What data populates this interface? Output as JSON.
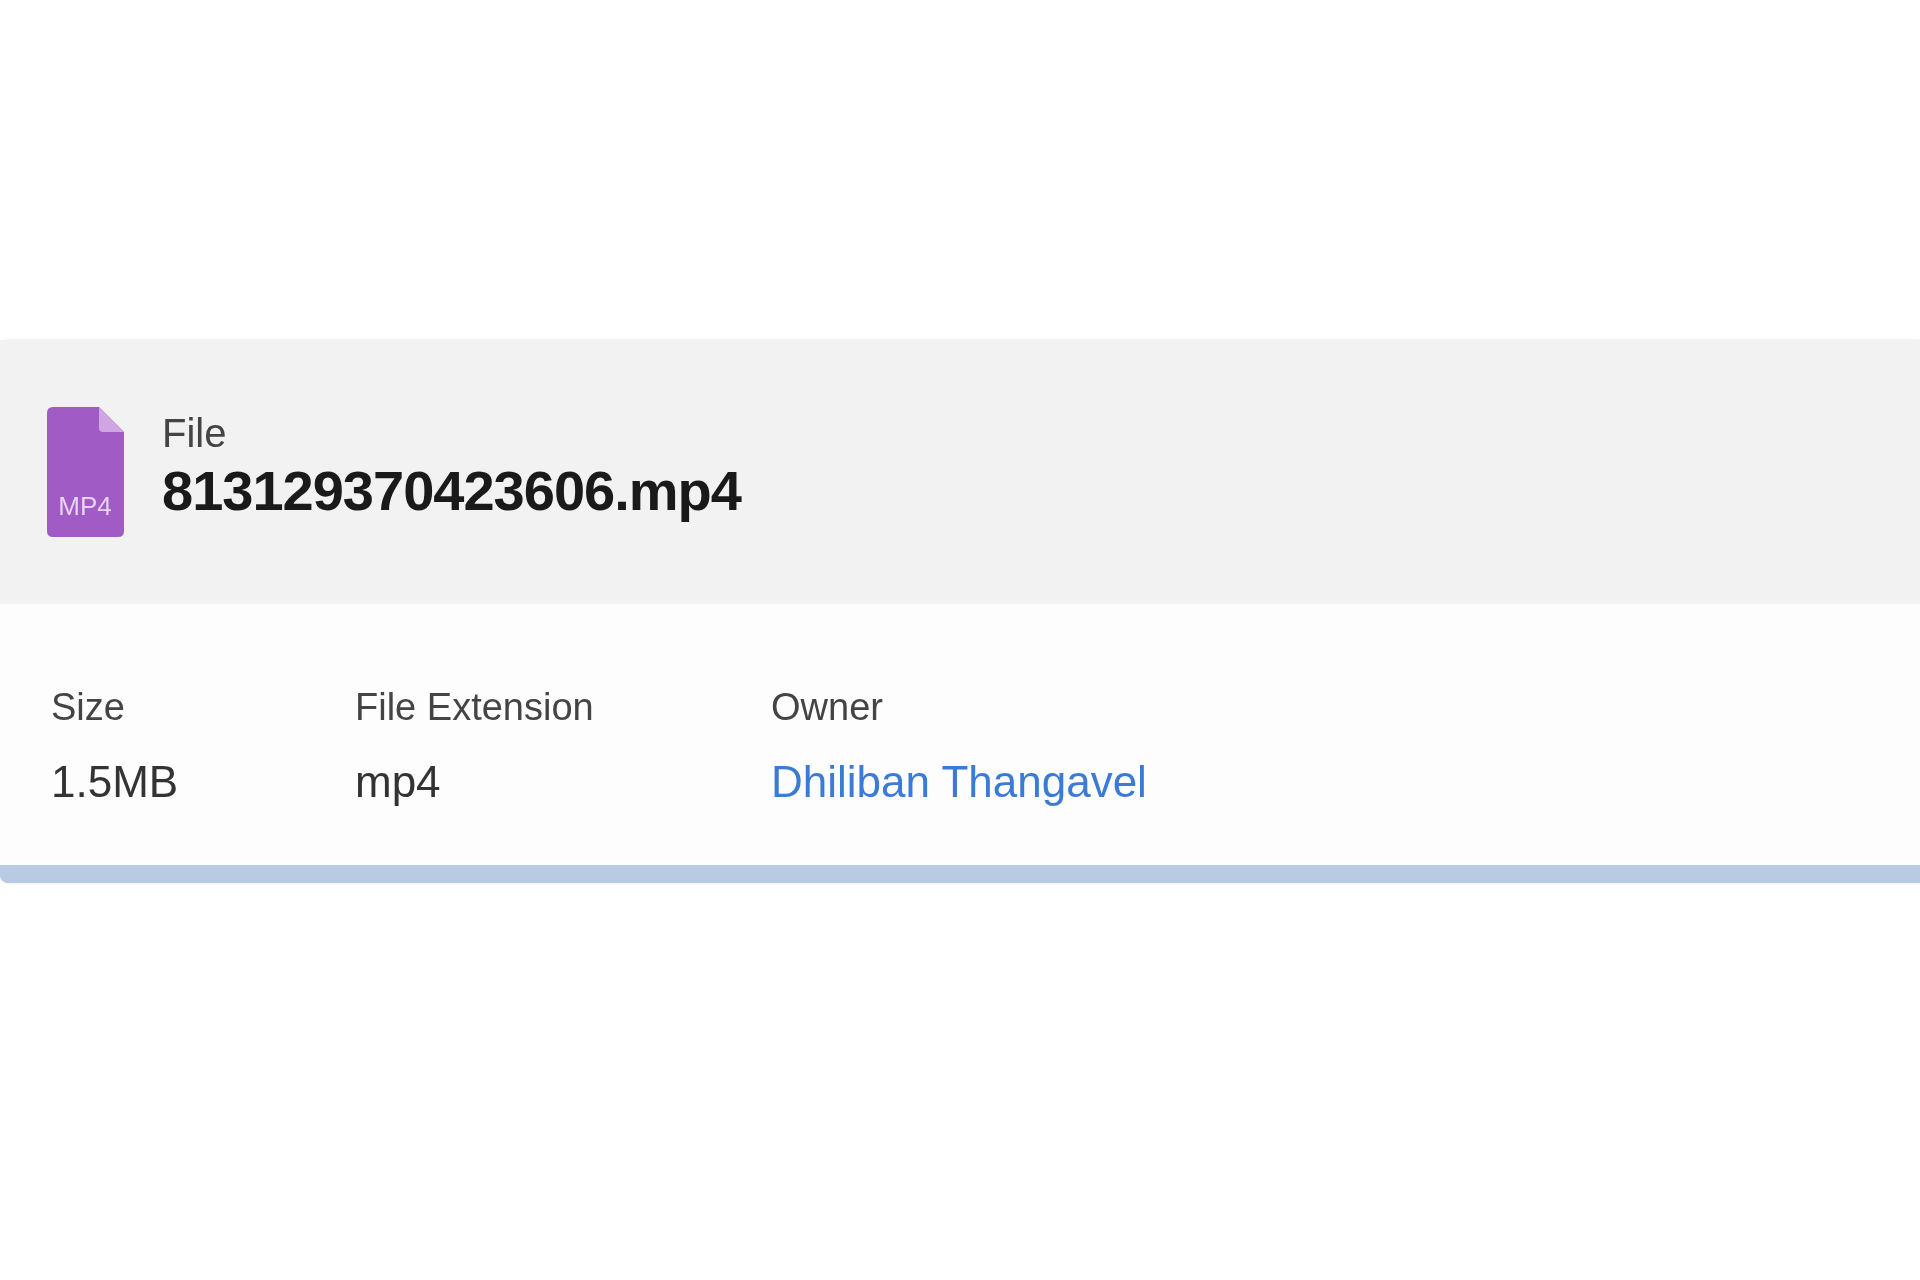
{
  "file": {
    "type_label": "File",
    "name": "813129370423606.mp4",
    "icon_text": "MP4"
  },
  "details": [
    {
      "label": "Size",
      "value": "1.5MB",
      "kind": "text"
    },
    {
      "label": "File Extension",
      "value": "mp4",
      "kind": "text"
    },
    {
      "label": "Owner",
      "value": "Dhiliban Thangavel",
      "kind": "link"
    }
  ]
}
